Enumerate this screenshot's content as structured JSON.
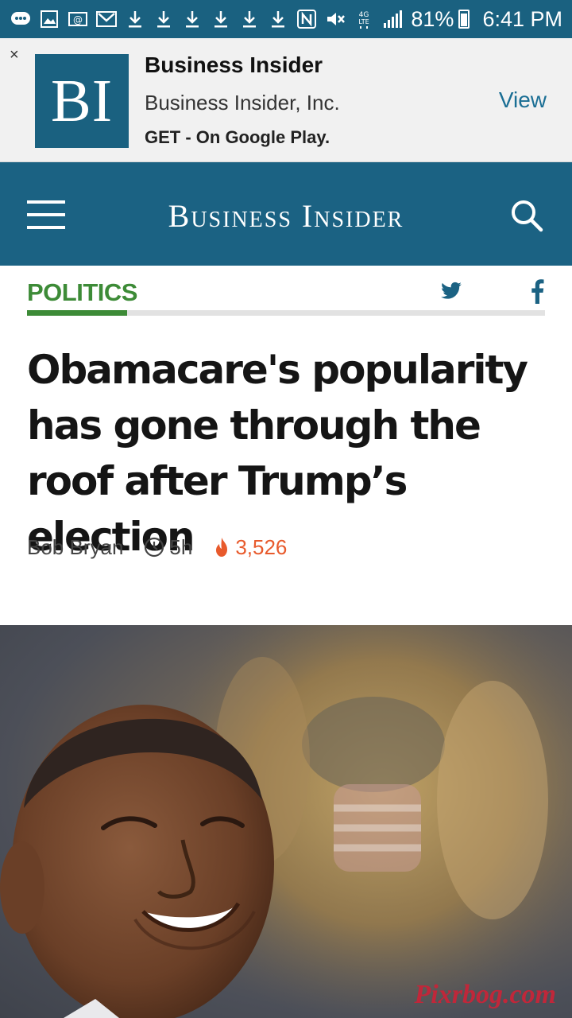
{
  "status_bar": {
    "battery": "81%",
    "time": "6:41 PM",
    "icons": [
      "messages-icon",
      "gallery-icon",
      "email-icon",
      "gmail-icon",
      "download-icon",
      "download-icon",
      "download-icon",
      "download-icon",
      "download-icon",
      "download-icon",
      "nfc-icon",
      "mute-icon",
      "4g-lte-icon",
      "signal-icon"
    ]
  },
  "app_banner": {
    "close": "×",
    "logo_text": "BI",
    "app_name": "Business Insider",
    "publisher": "Business Insider, Inc.",
    "cta": "GET - On Google Play.",
    "view": "View"
  },
  "header": {
    "logo_text": "Business Insider"
  },
  "section": {
    "label": "POLITICS"
  },
  "article": {
    "headline": "Obamacare's popularity has gone through the roof after Trump’s election",
    "author": "Bob Bryan",
    "time": "5h",
    "views": "3,526"
  },
  "hero": {
    "watermark": "Pixrbog.com"
  },
  "colors": {
    "brand_blue": "#1b6283",
    "section_green": "#3d8b37",
    "views_orange": "#e85a2c",
    "banner_bg": "#f1f1f1"
  }
}
